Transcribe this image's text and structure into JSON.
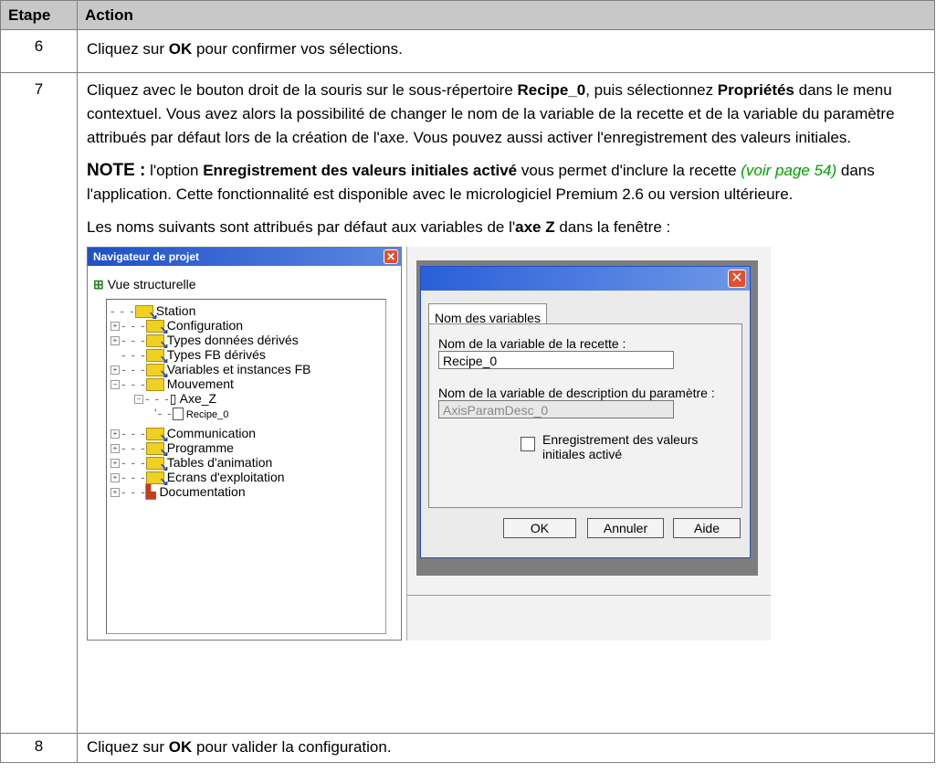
{
  "table": {
    "header": {
      "step": "Etape",
      "action": "Action"
    },
    "rows": {
      "r6": {
        "num": "6",
        "pre": "Cliquez sur ",
        "bold": "OK",
        "post": " pour confirmer vos sélections."
      },
      "r7": {
        "num": "7",
        "p1_a": "Cliquez avec le bouton droit de la souris sur le sous-répertoire ",
        "p1_b": "Recipe_0",
        "p1_c": ", puis sélectionnez ",
        "p1_d": "Propriétés",
        "p1_e": " dans le menu contextuel. Vous avez alors la possibilité de changer le nom de la variable de la recette et de la variable du paramètre attribués par défaut lors de la création de l'axe. Vous pouvez aussi activer l'enregistrement des valeurs initiales.",
        "note_label": "NOTE :",
        "note_a": " l'option ",
        "note_b": "Enregistrement des valeurs initiales activé",
        "note_c": " vous permet d'inclure la recette ",
        "note_link": "(voir page 54)",
        "note_d": " dans l'application. Cette fonctionnalité est disponible avec le micrologiciel Premium 2.6 ou version ultérieure.",
        "p3_a": "Les noms suivants sont attribués par défaut aux variables de l'",
        "p3_b": "axe Z",
        "p3_c": " dans la fenêtre :"
      },
      "r8": {
        "num": "8",
        "pre": "Cliquez sur ",
        "bold": "OK",
        "post": " pour valider la configuration."
      }
    }
  },
  "navigator": {
    "title": "Navigateur de projet",
    "view": "Vue structurelle",
    "tree": {
      "station": "Station",
      "configuration": "Configuration",
      "types_derives": "Types données dérivés",
      "types_fb": "Types FB dérivés",
      "variables": "Variables et instances FB",
      "mouvement": "Mouvement",
      "axe": "Axe_Z",
      "recipe": "Recipe_0",
      "communication": "Communication",
      "programme": "Programme",
      "tables": "Tables d'animation",
      "ecrans": "Ecrans d'exploitation",
      "documentation": "Documentation"
    }
  },
  "dialog": {
    "tab": "Nom des variables",
    "recipe_label": "Nom de la variable de la recette :",
    "recipe_value": "Recipe_0",
    "param_label": "Nom de la variable de description du paramètre :",
    "param_value": "AxisParamDesc_0",
    "checkbox_line1": "Enregistrement des valeurs",
    "checkbox_line2": "initiales activé",
    "ok": "OK",
    "cancel": "Annuler",
    "help": "Aide"
  }
}
